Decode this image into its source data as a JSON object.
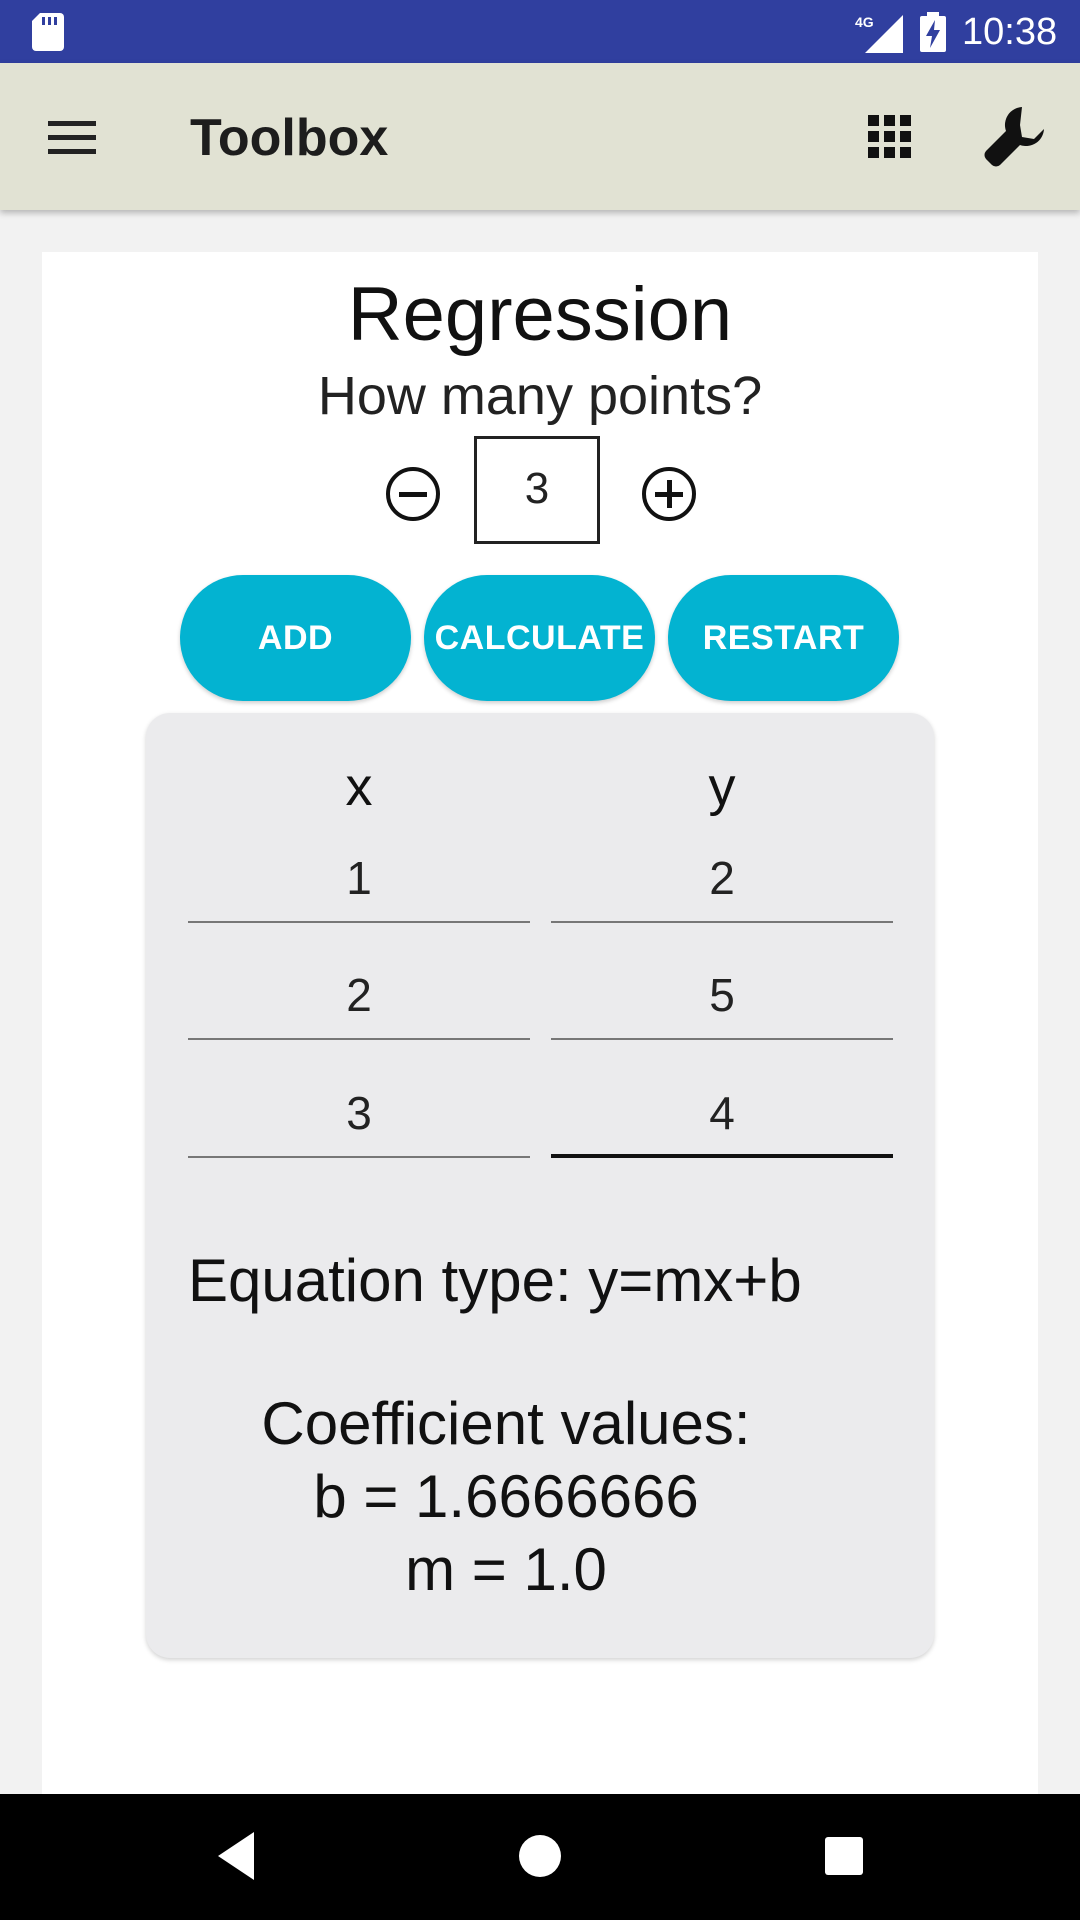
{
  "status_bar": {
    "time": "10:38",
    "network": "4G",
    "icons": [
      "sd-card-icon",
      "signal-icon",
      "battery-charging-icon"
    ]
  },
  "app_bar": {
    "title": "Toolbox",
    "icons": [
      "menu-icon",
      "apps-grid-icon",
      "wrench-icon"
    ]
  },
  "page": {
    "title": "Regression",
    "points_label": "How many points?",
    "points_value": "3"
  },
  "buttons": {
    "add": "ADD",
    "calculate": "CALCULATE",
    "restart": "RESTART"
  },
  "table": {
    "headers": {
      "x": "x",
      "y": "y"
    },
    "rows": [
      {
        "x": "1",
        "y": "2"
      },
      {
        "x": "2",
        "y": "5"
      },
      {
        "x": "3",
        "y": "4"
      }
    ]
  },
  "result": {
    "equation": "Equation type: y=mx+b",
    "coeff_title": "Coefficient values:",
    "b_line": "b = 1.6666666",
    "m_line": "m = 1.0"
  },
  "colors": {
    "status_bar": "#303f9f",
    "app_bar": "#e1e2d3",
    "accent_button": "#03b3d1",
    "card": "#ebebed"
  }
}
